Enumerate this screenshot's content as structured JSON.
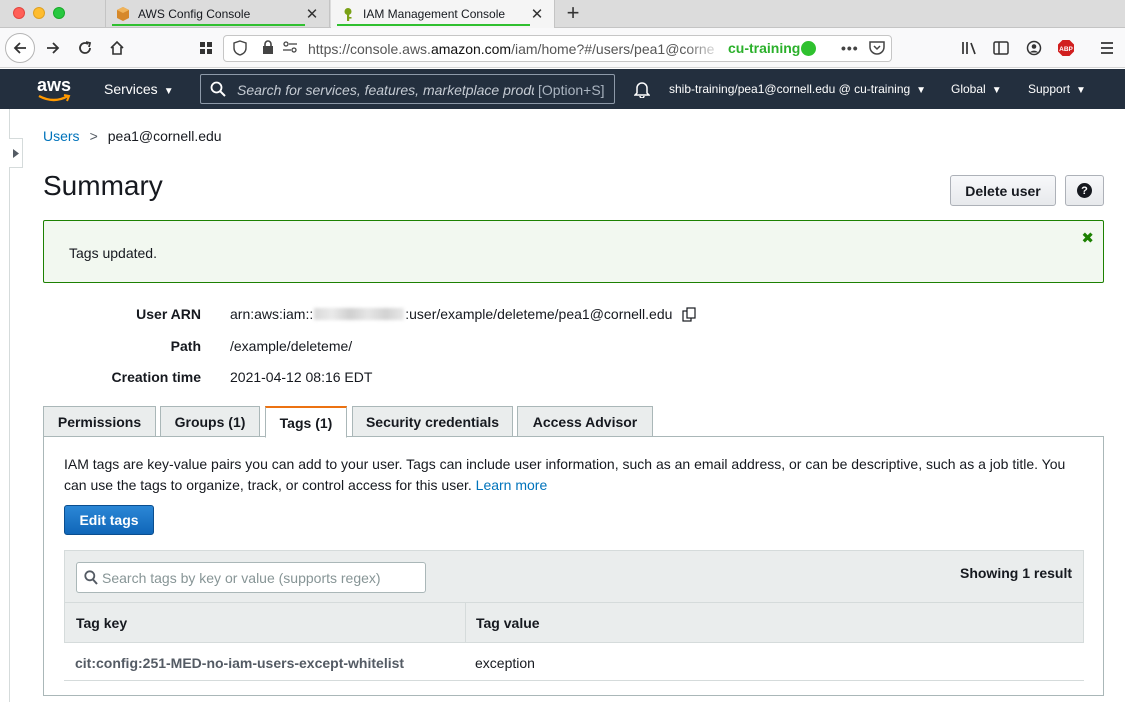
{
  "browser": {
    "tabs": [
      {
        "title": "AWS Config Console",
        "active": false
      },
      {
        "title": "IAM Management Console",
        "active": true
      }
    ],
    "url_prefix": "https://console.aws.",
    "url_domain": "amazon.com",
    "url_path": "/iam/home?#/users/pea1@corne",
    "container_label": "cu-training",
    "container_color": "#2fc12f",
    "abp_label": "ABP"
  },
  "aws_nav": {
    "logo_text": "aws",
    "services_label": "Services",
    "search_placeholder": "Search for services, features, marketplace products, and docs",
    "search_shortcut": "[Option+S]",
    "account": "shib-training/pea1@cornell.edu @ cu-training",
    "region": "Global",
    "support": "Support"
  },
  "breadcrumb": {
    "parent": "Users",
    "current": "pea1@cornell.edu"
  },
  "page": {
    "title": "Summary",
    "delete_button": "Delete user",
    "help_button": "?"
  },
  "alert": {
    "message": "Tags updated.",
    "color": "#1d8102"
  },
  "summary": {
    "arn_label": "User ARN",
    "arn_prefix": "arn:aws:iam::",
    "arn_suffix": ":user/example/deleteme/pea1@cornell.edu",
    "path_label": "Path",
    "path_value": "/example/deleteme/",
    "created_label": "Creation time",
    "created_value": "2021-04-12 08:16 EDT"
  },
  "tabs": {
    "permissions": "Permissions",
    "groups": "Groups (1)",
    "tags": "Tags (1)",
    "security": "Security credentials",
    "advisor": "Access Advisor",
    "active": "tags"
  },
  "tags_panel": {
    "description": "IAM tags are key-value pairs you can add to your user. Tags can include user information, such as an email address, or can be descriptive, such as a job title. You can use the tags to organize, track, or control access for this user.",
    "learn_more": "Learn more",
    "edit_button": "Edit tags",
    "search_placeholder": "Search tags by key or value (supports regex)",
    "result_count": "Showing 1 result",
    "columns": [
      "Tag key",
      "Tag value"
    ],
    "rows": [
      {
        "key": "cit:config:251-MED-no-iam-users-except-whitelist",
        "value": "exception"
      }
    ]
  },
  "colors": {
    "aws_nav_bg": "#232f3e",
    "link": "#0073bb",
    "primary_button": "#1066b8",
    "active_tab_accent": "#ec7211"
  }
}
